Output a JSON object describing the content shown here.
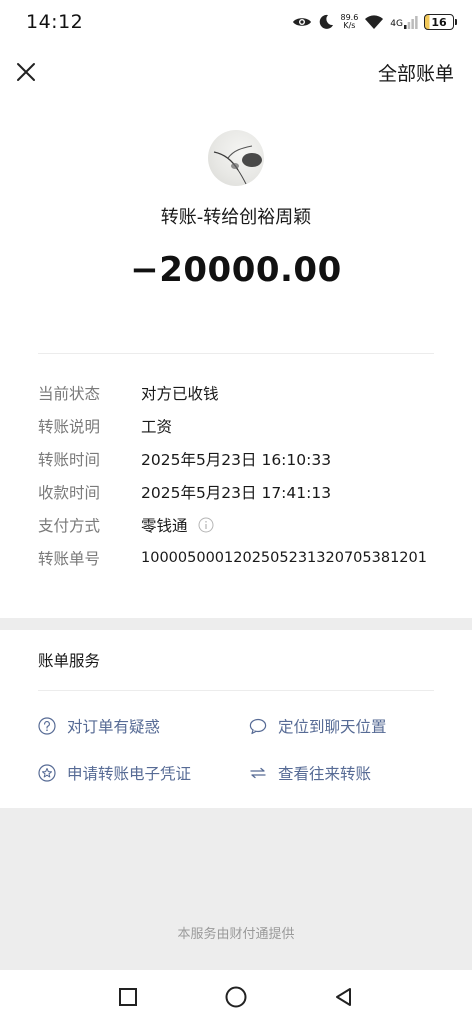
{
  "status_bar": {
    "time": "14:12",
    "net_speed_value": "89.6",
    "net_speed_unit": "K/s",
    "network": "4G",
    "battery": "16",
    "icons": [
      "eye-icon",
      "moon-icon",
      "wifi-icon",
      "signal-icon",
      "battery-icon"
    ]
  },
  "nav": {
    "close_icon": "close-icon",
    "all_bills_label": "全部账单"
  },
  "transfer": {
    "title": "转账-转给创裕周颖",
    "amount": "−20000.00",
    "details": [
      {
        "label": "当前状态",
        "value": "对方已收钱"
      },
      {
        "label": "转账说明",
        "value": "工资"
      },
      {
        "label": "转账时间",
        "value": "2025年5月23日 16:10:33"
      },
      {
        "label": "收款时间",
        "value": "2025年5月23日 17:41:13"
      },
      {
        "label": "支付方式",
        "value": "零钱通",
        "icon": "info-icon"
      },
      {
        "label": "转账单号",
        "value": "100005000120250523132070538120​1"
      }
    ]
  },
  "services": {
    "title": "账单服务",
    "links": [
      {
        "label": "对订单有疑惑",
        "icon": "question-icon"
      },
      {
        "label": "定位到聊天位置",
        "icon": "chat-bubble-icon"
      },
      {
        "label": "申请转账电子凭证",
        "icon": "star-badge-icon"
      },
      {
        "label": "查看往来转账",
        "icon": "swap-arrows-icon"
      }
    ]
  },
  "footer": {
    "text": "本服务由财付通提供"
  },
  "system_nav": {
    "icons": [
      "recents-square-icon",
      "home-circle-icon",
      "back-triangle-icon"
    ]
  },
  "colors": {
    "link": "#576b95",
    "label": "#7a7a7a",
    "background": "#ededed"
  }
}
